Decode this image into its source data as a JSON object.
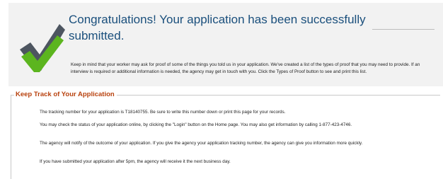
{
  "confirmation": {
    "headline": "Congratulations! Your application has been successfully submitted.",
    "intro": "Keep in mind that your worker may ask for proof of some of the things you told us in your application. We've created a list of the types of proof that you may need to provide. If an interview is required or additional information is needed, the agency may get in touch with you. Click the Types of Proof button to see and print this list.",
    "icon": "checkmark-icon",
    "colors": {
      "check_green": "#5cb51f",
      "check_gray": "#4d5560",
      "headline": "#1a4f7c",
      "section_title": "#b8420e"
    }
  },
  "track": {
    "title": "Keep Track of Your Application",
    "lines": [
      "The tracking number for your application is T18140755. Be sure to write this number down or print this page for your records.",
      "You may check the status of your application online, by clicking the \"Login\" button on the Home page. You may also get information by calling 1-877-423-4746.",
      "The agency will notify of the outcome of your application. If you give the agency your application tracking number, the agency can give you information more quickly.",
      "If you have submitted your application after 5pm, the agency will receive it the next business day."
    ]
  }
}
